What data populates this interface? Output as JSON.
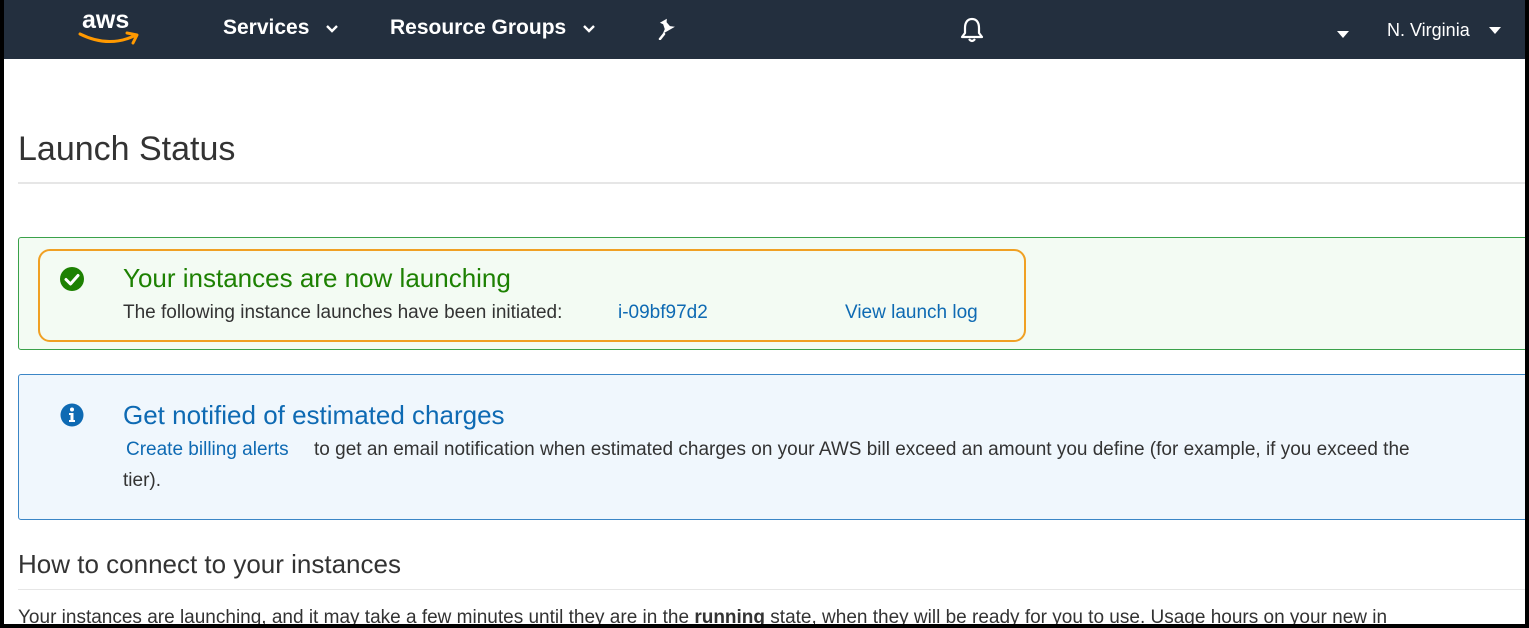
{
  "nav": {
    "logo_text": "aws",
    "services_label": "Services",
    "resource_groups_label": "Resource Groups",
    "region_label": "N. Virginia"
  },
  "page": {
    "title": "Launch Status"
  },
  "success_alert": {
    "title": "Your instances are now launching",
    "text": "The following instance launches have been initiated:",
    "instance_id": "i-09bf97d2",
    "view_log_label": "View launch log"
  },
  "info_alert": {
    "title": "Get notified of estimated charges",
    "billing_link": "Create billing alerts",
    "text_line1": "to get an email notification when estimated charges on your AWS bill exceed an amount you define (for example, if you exceed the",
    "text_line2": "tier)."
  },
  "connect": {
    "title": "How to connect to your instances",
    "text_before": "Your instances are launching, and it may take a few minutes until they are in the ",
    "text_bold": "running",
    "text_after": " state, when they will be ready for you to use. Usage hours on your new in"
  },
  "colors": {
    "nav_bg": "#232f3e",
    "success": "#1d8102",
    "link": "#0e6ab3",
    "highlight": "#f0a023"
  }
}
